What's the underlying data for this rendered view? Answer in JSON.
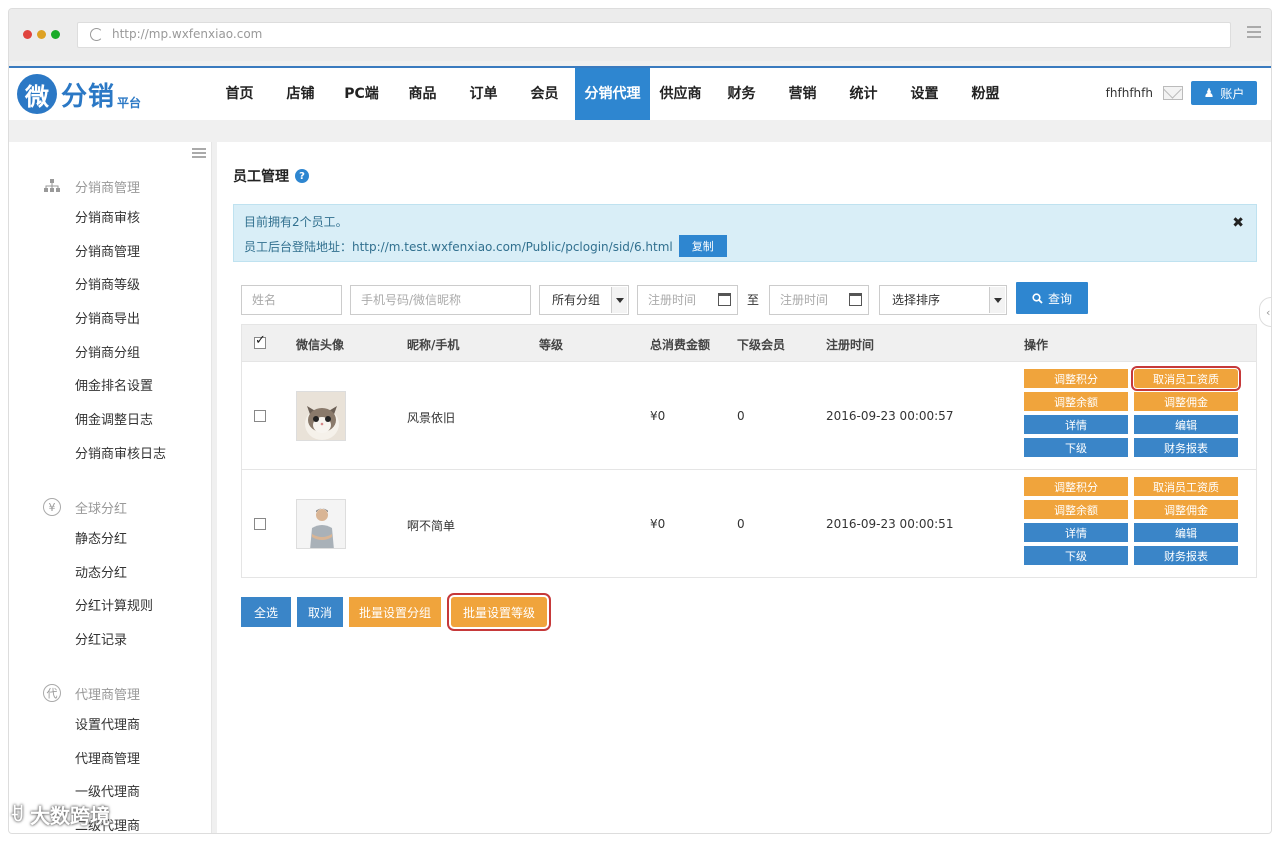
{
  "browser": {
    "url": "http://mp.wxfenxiao.com"
  },
  "header": {
    "logo_mark": "微",
    "logo_text": "分销",
    "logo_sub": "平台",
    "nav": [
      "首页",
      "店铺",
      "PC端",
      "商品",
      "订单",
      "会员",
      "分销代理",
      "供应商",
      "财务",
      "营销",
      "统计",
      "设置",
      "粉盟"
    ],
    "active_nav": "分销代理",
    "username": "fhfhfhfh",
    "account_label": "账户",
    "accent_color": "#2e86d0"
  },
  "sidebar": {
    "groups": [
      {
        "title": "分销商管理",
        "icon": "org-chart-icon",
        "items": [
          "分销商审核",
          "分销商管理",
          "分销商等级",
          "分销商导出",
          "分销商分组",
          "佣金排名设置",
          "佣金调整日志",
          "分销商审核日志"
        ]
      },
      {
        "title": "全球分红",
        "icon": "yen-icon",
        "items": [
          "静态分红",
          "动态分红",
          "分红计算规则",
          "分红记录"
        ]
      },
      {
        "title": "代理商管理",
        "icon": "agent-icon",
        "items": [
          "设置代理商",
          "代理商管理",
          "一级代理商",
          "二级代理商"
        ]
      }
    ]
  },
  "main": {
    "title": "员工管理",
    "alert": {
      "line1": "目前拥有2个员工。",
      "line2": "员工后台登陆地址：http://m.test.wxfenxiao.com/Public/pclogin/sid/6.html",
      "copy_label": "复制"
    },
    "filters": {
      "name_placeholder": "姓名",
      "phone_placeholder": "手机号码/微信昵称",
      "group_select": "所有分组",
      "date_from_placeholder": "注册时间",
      "to_label": "至",
      "date_to_placeholder": "注册时间",
      "sort_select": "选择排序",
      "search_label": "查询"
    },
    "table": {
      "headers": [
        "微信头像",
        "昵称/手机",
        "等级",
        "总消费金额",
        "下级会员",
        "注册时间",
        "操作"
      ],
      "rows": [
        {
          "nickname": "风景依旧",
          "level": "",
          "total": "¥0",
          "subs": "0",
          "registered": "2016-09-23 00:00:57",
          "avatar": "cat-avatar"
        },
        {
          "nickname": "啊不简单",
          "level": "",
          "total": "¥0",
          "subs": "0",
          "registered": "2016-09-23 00:00:51",
          "avatar": "person-avatar"
        }
      ],
      "ops": [
        "调整积分",
        "取消员工资质",
        "调整余额",
        "调整佣金",
        "详情",
        "编辑",
        "下级",
        "财务报表"
      ]
    },
    "bulk": {
      "select_all": "全选",
      "cancel": "取消",
      "set_group": "批量设置分组",
      "set_level": "批量设置等级"
    }
  },
  "watermark": "大数跨境"
}
